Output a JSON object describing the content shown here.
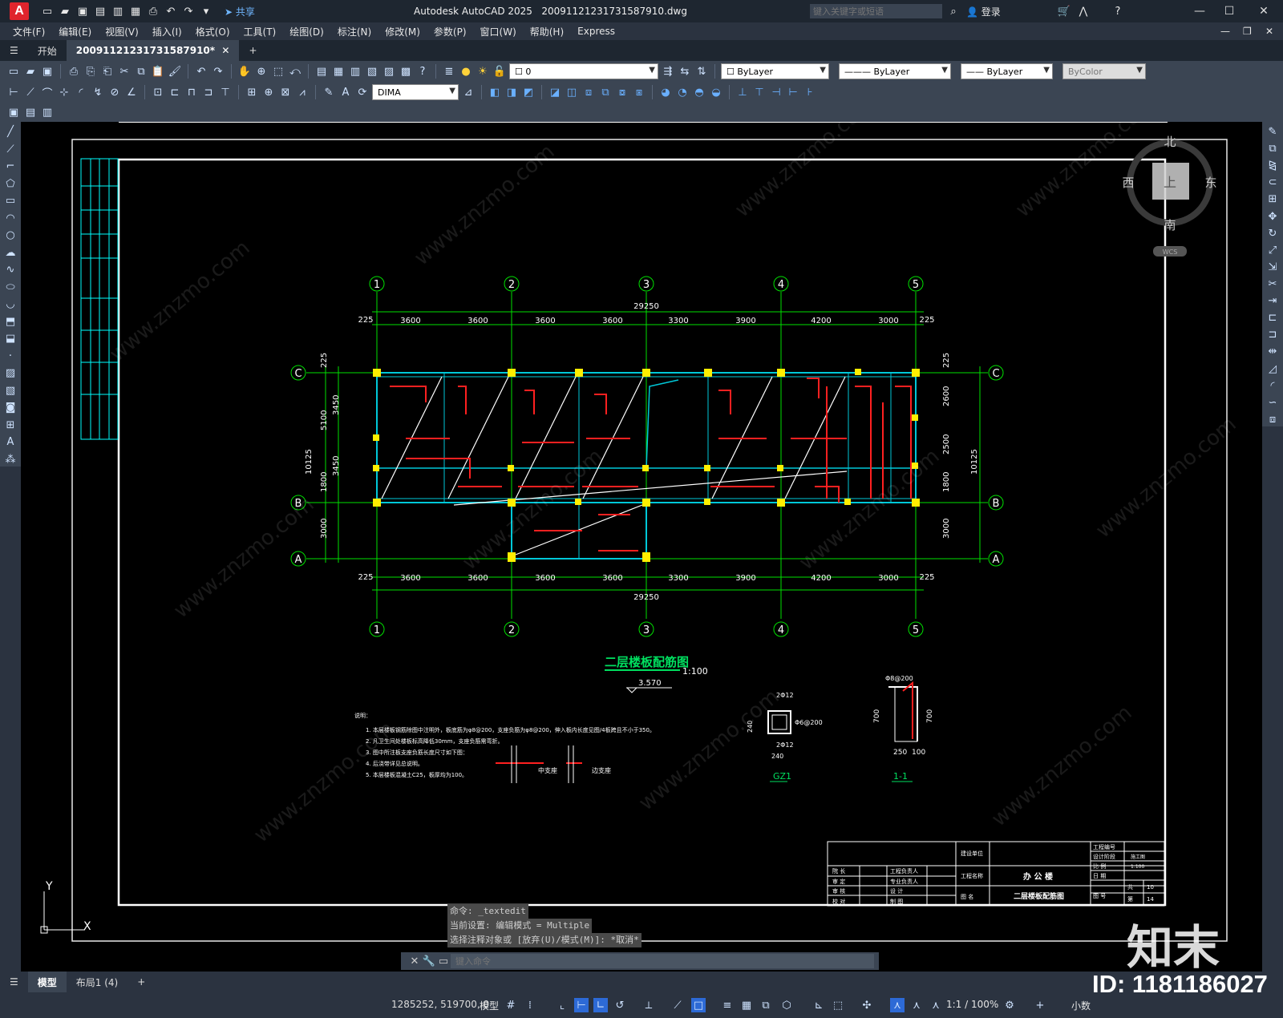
{
  "app": {
    "logo": "A",
    "share": "共享",
    "title": "Autodesk AutoCAD 2025",
    "filename": "20091121231731587910.dwg",
    "search_placeholder": "键入关键字或短语",
    "login": "登录"
  },
  "menu": [
    "文件(F)",
    "编辑(E)",
    "视图(V)",
    "插入(I)",
    "格式(O)",
    "工具(T)",
    "绘图(D)",
    "标注(N)",
    "修改(M)",
    "参数(P)",
    "窗口(W)",
    "帮助(H)",
    "Express"
  ],
  "tabs": {
    "start": "开始",
    "file": "20091121231731587910*"
  },
  "props": {
    "layer": "0",
    "color": "ByLayer",
    "linetype": "ByLayer",
    "lineweight": "ByLayer",
    "plotstyle": "ByColor",
    "dimstyle": "DIMA"
  },
  "viewcube": {
    "north": "北",
    "south": "南",
    "east": "东",
    "west": "西",
    "top": "上",
    "wcs": "WCS"
  },
  "drawing": {
    "axes_top": [
      "1",
      "2",
      "3",
      "4",
      "5"
    ],
    "axes_side": [
      "C",
      "B",
      "A"
    ],
    "total": "29250",
    "spans": [
      "3600",
      "3600",
      "3600",
      "3600",
      "3300",
      "3900",
      "4200",
      "3000"
    ],
    "edge": "225",
    "left_dims": [
      "5100",
      "3450",
      "10125",
      "1800",
      "3450",
      "3000",
      "225"
    ],
    "right_dims": [
      "2600",
      "2500",
      "10125",
      "1800",
      "3000",
      "225"
    ],
    "title": "二层楼板配筋图",
    "scale": "1:100",
    "elevation": "3.570",
    "column_label": "GZ1",
    "section_label": "1-1",
    "notes_title": "说明：",
    "notes": [
      "1. 本层楼板钢筋除图中注明外，板底筋为φ8@200，支座负筋为φ8@200，伸入板内长度见图/4板跨且不小于350。",
      "2. 凡卫生间处楼板标高降低30mm，支座负筋需弯折。",
      "3. 图中所注板支座负筋长度尺寸如下图：",
      "4. 后浇带详见总说明。",
      "5. 本层楼板混凝土C25，板厚均为100。"
    ],
    "detail_labels": [
      "中支座",
      "边支座"
    ],
    "gz_dims": [
      "240",
      "240",
      "2Φ12",
      "Φ6@200",
      "2Φ12"
    ],
    "section_dims": [
      "Φ8@200",
      "700",
      "250",
      "100",
      "700"
    ]
  },
  "titleblock": {
    "unit": "建设单位",
    "project": "工程名称",
    "project_name": "办 公 楼",
    "drawing_name_label": "图  名",
    "drawing_name": "二层楼板配筋图",
    "no": "工程编号",
    "stage": "设计阶段",
    "stage_val": "施工图",
    "scale_label": "比  例",
    "scale_val": "1:100",
    "date": "日  期",
    "sheet": "图  号",
    "total_label": "共",
    "total_val": "10",
    "page_label": "第",
    "page_val": "14",
    "rows": [
      "院  长",
      "审  定",
      "审  核",
      "校  对"
    ],
    "roles": [
      "工程负责人",
      "专业负责人",
      "设  计",
      "制  图"
    ]
  },
  "command": {
    "history": [
      "命令: _textedit",
      "当前设置: 编辑模式 = Multiple",
      "选择注释对象或 [放弃(U)/模式(M)]: *取消*"
    ],
    "placeholder": "键入命令"
  },
  "layouts": {
    "model": "模型",
    "layout1": "布局1 (4)"
  },
  "status": {
    "coords": "1285252, 519700, 0",
    "model": "模型",
    "scale": "1:1 / 100%",
    "units": "小数"
  },
  "watermark": {
    "brand": "知末",
    "id": "ID: 1181186027",
    "url": "www.znzmo.com"
  },
  "ucs": {
    "x": "X",
    "y": "Y"
  }
}
